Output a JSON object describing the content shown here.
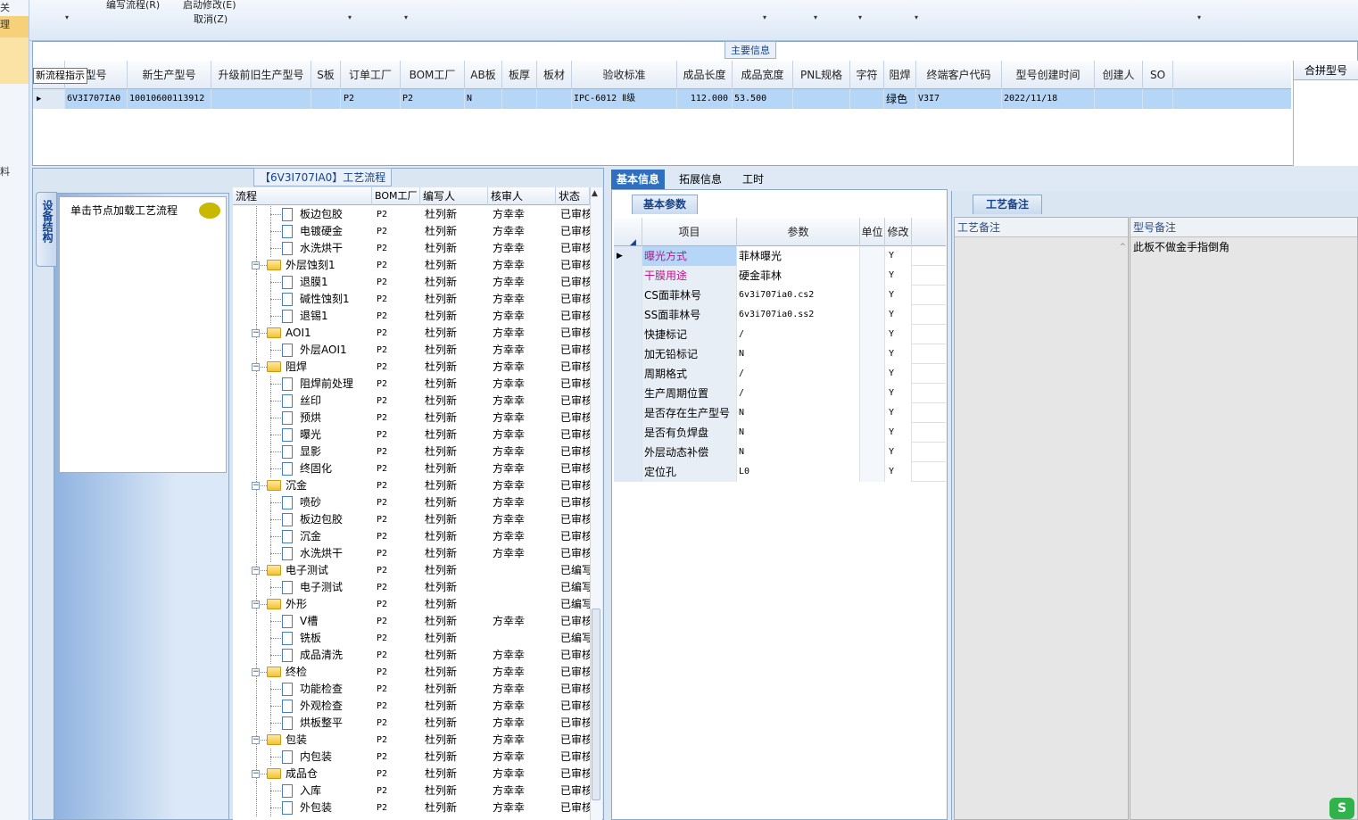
{
  "left_strip": {
    "items": [
      "关",
      "理",
      "",
      "料"
    ]
  },
  "toolbar": {
    "edit_flow": "编写流程(R)",
    "start_modify": "启动修改(E)",
    "cancel": "取消(Z)"
  },
  "main_group": {
    "title": "主要信息",
    "merge_label": "合拼型号"
  },
  "tooltip": "新流程指示",
  "top_grid": {
    "headers": [
      "型号",
      "新生产型号",
      "升级前旧生产型号",
      "S板",
      "订单工厂",
      "BOM工厂",
      "AB板",
      "板厚",
      "板材",
      "验收标准",
      "成品长度",
      "成品宽度",
      "PNL规格",
      "字符",
      "阻焊",
      "终端客户代码",
      "型号创建时间",
      "创建人",
      "SO"
    ],
    "row": [
      "6V3I707IA0",
      "10010600113912",
      "",
      "",
      "P2",
      "P2",
      "N",
      "",
      "",
      "IPC-6012 Ⅱ级",
      "112.000",
      "53.500",
      "",
      "",
      "绿色",
      "V3I7",
      "2022/11/18",
      "",
      ""
    ]
  },
  "process_panel": {
    "title": "【6V3I707IA0】工艺流程",
    "side_tab": "设备结构",
    "side_hint": "单击节点加载工艺流程",
    "tree_headers": [
      "流程",
      "BOM工厂",
      "编写人",
      "核审人",
      "状态"
    ]
  },
  "tree_rows": [
    {
      "name": "板边包胶",
      "folder": false,
      "bom": "P2",
      "writer": "杜列新",
      "reviewer": "方幸幸",
      "status": "已审核"
    },
    {
      "name": "电镀硬金",
      "folder": false,
      "bom": "P2",
      "writer": "杜列新",
      "reviewer": "方幸幸",
      "status": "已审核"
    },
    {
      "name": "水洗烘干",
      "folder": false,
      "bom": "P2",
      "writer": "杜列新",
      "reviewer": "方幸幸",
      "status": "已审核"
    },
    {
      "name": "外层蚀刻1",
      "folder": true,
      "bom": "P2",
      "writer": "杜列新",
      "reviewer": "方幸幸",
      "status": "已审核"
    },
    {
      "name": "退膜1",
      "folder": false,
      "bom": "P2",
      "writer": "杜列新",
      "reviewer": "方幸幸",
      "status": "已审核"
    },
    {
      "name": "碱性蚀刻1",
      "folder": false,
      "bom": "P2",
      "writer": "杜列新",
      "reviewer": "方幸幸",
      "status": "已审核"
    },
    {
      "name": "退锡1",
      "folder": false,
      "bom": "P2",
      "writer": "杜列新",
      "reviewer": "方幸幸",
      "status": "已审核"
    },
    {
      "name": "AOI1",
      "folder": true,
      "bom": "P2",
      "writer": "杜列新",
      "reviewer": "方幸幸",
      "status": "已审核"
    },
    {
      "name": "外层AOI1",
      "folder": false,
      "bom": "P2",
      "writer": "杜列新",
      "reviewer": "方幸幸",
      "status": "已审核"
    },
    {
      "name": "阻焊",
      "folder": true,
      "bom": "P2",
      "writer": "杜列新",
      "reviewer": "方幸幸",
      "status": "已审核"
    },
    {
      "name": "阻焊前处理",
      "folder": false,
      "bom": "P2",
      "writer": "杜列新",
      "reviewer": "方幸幸",
      "status": "已审核"
    },
    {
      "name": "丝印",
      "folder": false,
      "bom": "P2",
      "writer": "杜列新",
      "reviewer": "方幸幸",
      "status": "已审核"
    },
    {
      "name": "预烘",
      "folder": false,
      "bom": "P2",
      "writer": "杜列新",
      "reviewer": "方幸幸",
      "status": "已审核"
    },
    {
      "name": "曝光",
      "folder": false,
      "bom": "P2",
      "writer": "杜列新",
      "reviewer": "方幸幸",
      "status": "已审核"
    },
    {
      "name": "显影",
      "folder": false,
      "bom": "P2",
      "writer": "杜列新",
      "reviewer": "方幸幸",
      "status": "已审核"
    },
    {
      "name": "终固化",
      "folder": false,
      "bom": "P2",
      "writer": "杜列新",
      "reviewer": "方幸幸",
      "status": "已审核"
    },
    {
      "name": "沉金",
      "folder": true,
      "bom": "P2",
      "writer": "杜列新",
      "reviewer": "方幸幸",
      "status": "已审核"
    },
    {
      "name": "喷砂",
      "folder": false,
      "bom": "P2",
      "writer": "杜列新",
      "reviewer": "方幸幸",
      "status": "已审核"
    },
    {
      "name": "板边包胶",
      "folder": false,
      "bom": "P2",
      "writer": "杜列新",
      "reviewer": "方幸幸",
      "status": "已审核"
    },
    {
      "name": "沉金",
      "folder": false,
      "bom": "P2",
      "writer": "杜列新",
      "reviewer": "方幸幸",
      "status": "已审核"
    },
    {
      "name": "水洗烘干",
      "folder": false,
      "bom": "P2",
      "writer": "杜列新",
      "reviewer": "方幸幸",
      "status": "已审核"
    },
    {
      "name": "电子测试",
      "folder": true,
      "bom": "P2",
      "writer": "杜列新",
      "reviewer": "",
      "status": "已编写"
    },
    {
      "name": "电子测试",
      "folder": false,
      "bom": "P2",
      "writer": "杜列新",
      "reviewer": "",
      "status": "已编写"
    },
    {
      "name": "外形",
      "folder": true,
      "bom": "P2",
      "writer": "杜列新",
      "reviewer": "",
      "status": "已编写"
    },
    {
      "name": "V槽",
      "folder": false,
      "bom": "P2",
      "writer": "杜列新",
      "reviewer": "方幸幸",
      "status": "已审核"
    },
    {
      "name": "铣板",
      "folder": false,
      "bom": "P2",
      "writer": "杜列新",
      "reviewer": "",
      "status": "已编写"
    },
    {
      "name": "成品清洗",
      "folder": false,
      "bom": "P2",
      "writer": "杜列新",
      "reviewer": "方幸幸",
      "status": "已审核"
    },
    {
      "name": "终检",
      "folder": true,
      "bom": "P2",
      "writer": "杜列新",
      "reviewer": "方幸幸",
      "status": "已审核"
    },
    {
      "name": "功能检查",
      "folder": false,
      "bom": "P2",
      "writer": "杜列新",
      "reviewer": "方幸幸",
      "status": "已审核"
    },
    {
      "name": "外观检查",
      "folder": false,
      "bom": "P2",
      "writer": "杜列新",
      "reviewer": "方幸幸",
      "status": "已审核"
    },
    {
      "name": "烘板整平",
      "folder": false,
      "bom": "P2",
      "writer": "杜列新",
      "reviewer": "方幸幸",
      "status": "已审核"
    },
    {
      "name": "包装",
      "folder": true,
      "bom": "P2",
      "writer": "杜列新",
      "reviewer": "方幸幸",
      "status": "已审核"
    },
    {
      "name": "内包装",
      "folder": false,
      "bom": "P2",
      "writer": "杜列新",
      "reviewer": "方幸幸",
      "status": "已审核"
    },
    {
      "name": "成品仓",
      "folder": true,
      "bom": "P2",
      "writer": "杜列新",
      "reviewer": "方幸幸",
      "status": "已审核"
    },
    {
      "name": "入库",
      "folder": false,
      "bom": "P2",
      "writer": "杜列新",
      "reviewer": "方幸幸",
      "status": "已审核"
    },
    {
      "name": "外包装",
      "folder": false,
      "bom": "P2",
      "writer": "杜列新",
      "reviewer": "方幸幸",
      "status": "已审核"
    }
  ],
  "tabs": [
    "基本信息",
    "拓展信息",
    "工时"
  ],
  "basic_panel": {
    "title": "基本参数",
    "headers": [
      "项目",
      "参数",
      "单位",
      "修改"
    ],
    "rows": [
      {
        "item": "曝光方式",
        "value": "菲林曝光",
        "unit": "",
        "mod": "Y",
        "highlight": true
      },
      {
        "item": "干膜用途",
        "value": "硬金菲林",
        "unit": "",
        "mod": "Y",
        "highlight": true
      },
      {
        "item": "CS面菲林号",
        "value": "6v3i707ia0.cs2",
        "unit": "",
        "mod": "Y",
        "highlight": false
      },
      {
        "item": "SS面菲林号",
        "value": "6v3i707ia0.ss2",
        "unit": "",
        "mod": "Y",
        "highlight": false
      },
      {
        "item": "快捷标记",
        "value": "/",
        "unit": "",
        "mod": "Y",
        "highlight": false
      },
      {
        "item": "加无铅标记",
        "value": "N",
        "unit": "",
        "mod": "Y",
        "highlight": false
      },
      {
        "item": "周期格式",
        "value": "/",
        "unit": "",
        "mod": "Y",
        "highlight": false
      },
      {
        "item": "生产周期位置",
        "value": "/",
        "unit": "",
        "mod": "Y",
        "highlight": false
      },
      {
        "item": "是否存在生产型号",
        "value": "N",
        "unit": "",
        "mod": "Y",
        "highlight": false
      },
      {
        "item": "是否有负焊盘",
        "value": "N",
        "unit": "",
        "mod": "Y",
        "highlight": false
      },
      {
        "item": "外层动态补偿",
        "value": "N",
        "unit": "",
        "mod": "Y",
        "highlight": false
      },
      {
        "item": "定位孔",
        "value": "L0",
        "unit": "",
        "mod": "Y",
        "highlight": false
      }
    ]
  },
  "right_panel": {
    "title": "工艺备注",
    "memo1_label": "工艺备注",
    "memo2_label": "型号备注",
    "memo2_text": "此板不做金手指倒角"
  },
  "colors": {
    "selected_row": "#b6d6f8",
    "highlight_text": "#c0148c",
    "tab_active": "#2f6fbf"
  }
}
